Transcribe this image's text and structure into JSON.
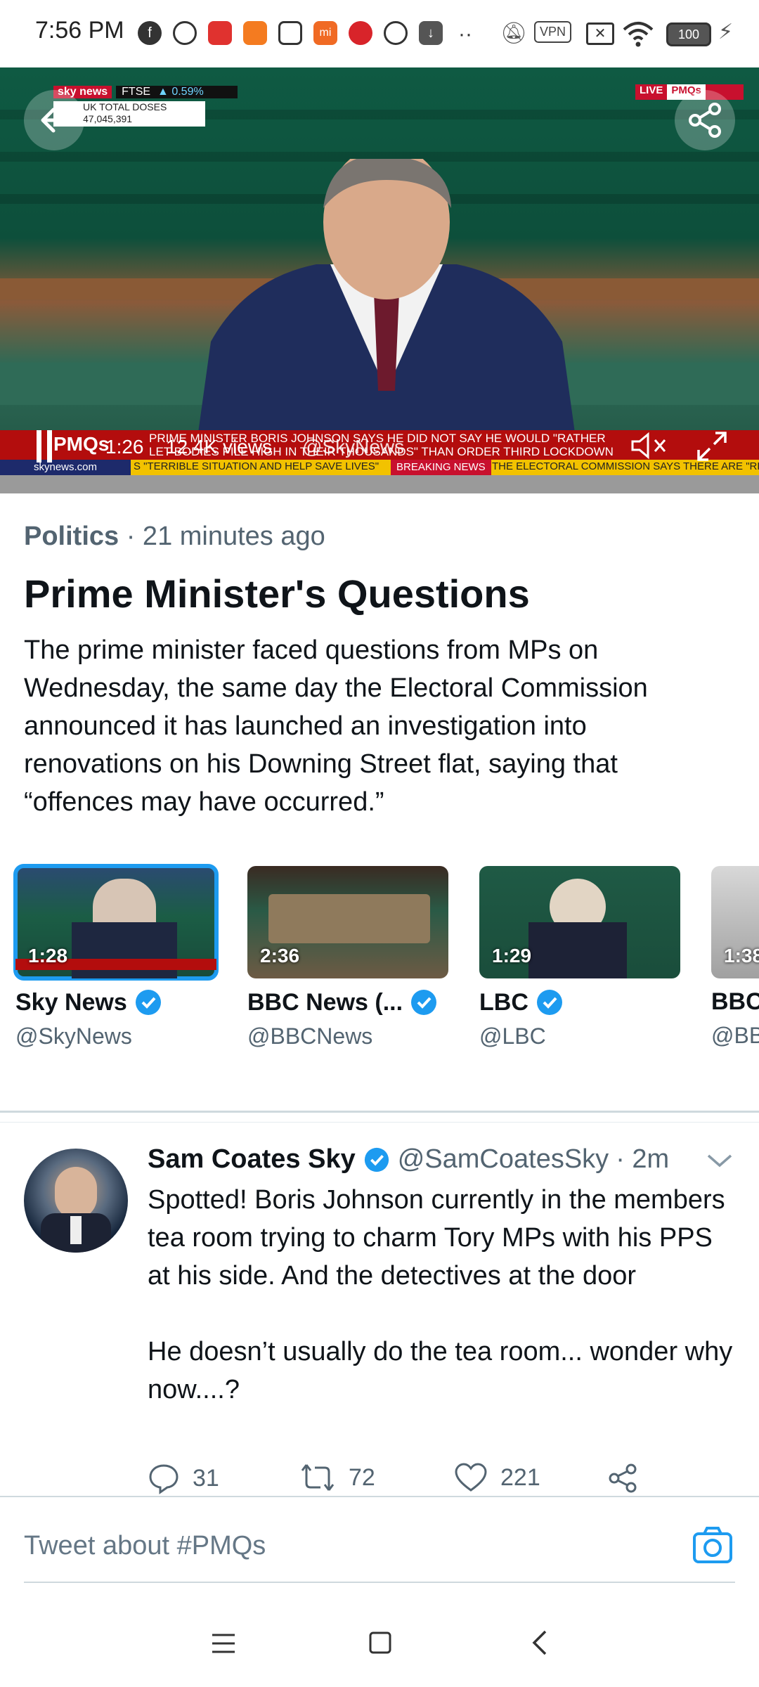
{
  "status_bar": {
    "time": "7:56 PM",
    "battery": "100",
    "vpn": "VPN"
  },
  "video": {
    "channel_logo": "sky news",
    "ftse_label": "FTSE",
    "ftse_change": "▲ 0.59%",
    "doses_label": "UK TOTAL DOSES",
    "doses_value": "47,045,391",
    "live_badge": "LIVE",
    "pmqs_badge": "PMQs",
    "ticker_label": "PMQs",
    "ticker_headline_1": "PRIME MINISTER BORIS JOHNSON SAYS HE DID NOT SAY HE WOULD \"RATHER",
    "ticker_headline_2": "LET BODIES PILE HIGH IN THEIR THOUSANDS\" THAN ORDER THIRD LOCKDOWN",
    "site": "skynews.com",
    "breaking_text": "S \"TERRIBLE SITUATION AND HELP SAVE LIVES\"",
    "breaking_label": "BREAKING NEWS",
    "breaking_text_2": "THE ELECTORAL COMMISSION SAYS THERE ARE \"RE",
    "elapsed": "1:26",
    "views": "12.4K views",
    "source_handle": "@SkyNews"
  },
  "article": {
    "category": "Politics",
    "time_ago": "· 21 minutes ago",
    "title": "Prime Minister's Questions",
    "description": "The prime minister faced questions from MPs on Wednesday, the same day the Electoral Commission announced it has launched an investigation into renovations on his Downing Street flat, saying that “offences may have occurred.”"
  },
  "carousel": [
    {
      "duration": "1:28",
      "name": "Sky News",
      "handle": "@SkyNews",
      "verified": true,
      "selected": true
    },
    {
      "duration": "2:36",
      "name": "BBC News (...",
      "handle": "@BBCNews",
      "verified": true,
      "selected": false
    },
    {
      "duration": "1:29",
      "name": "LBC",
      "handle": "@LBC",
      "verified": true,
      "selected": false
    },
    {
      "duration": "1:38",
      "name": "BBC",
      "handle": "@BB",
      "verified": false,
      "selected": false
    }
  ],
  "tweet": {
    "name": "Sam Coates Sky",
    "handle": "@SamCoatesSky",
    "time": "· 2m",
    "body_1": "Spotted! Boris Johnson currently in the members tea room trying to charm Tory MPs with his PPS at his side. And the detectives at the door",
    "body_2": "He doesn’t usually do the tea room... wonder why now....?",
    "replies": "31",
    "retweets": "72",
    "likes": "221"
  },
  "compose": {
    "placeholder": "Tweet about #PMQs"
  },
  "colors": {
    "accent": "#1d9bf0",
    "text": "#0f1419",
    "muted": "#536471"
  }
}
